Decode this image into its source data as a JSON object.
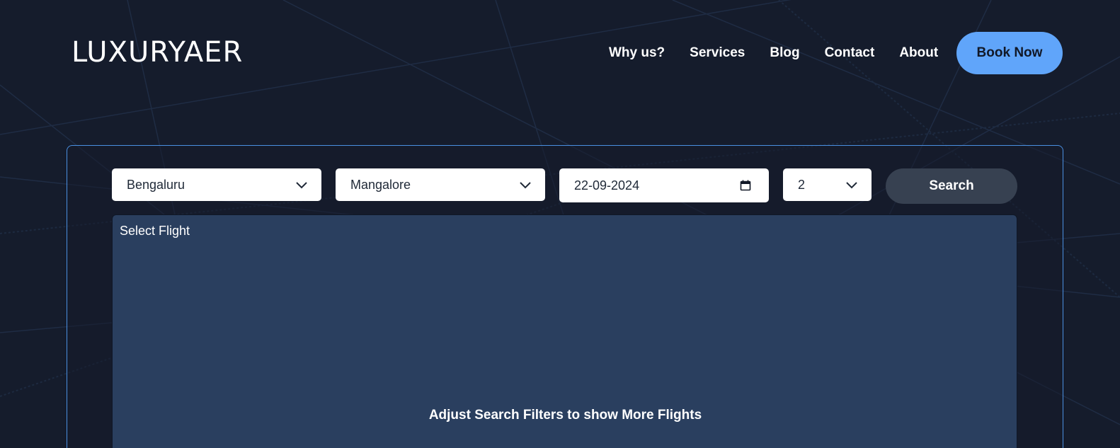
{
  "header": {
    "logo": "LUXURYAER",
    "nav": [
      "Why us?",
      "Services",
      "Blog",
      "Contact",
      "About"
    ],
    "cta_label": "Book Now"
  },
  "search": {
    "from": "Bengaluru",
    "to": "Mangalore",
    "date": "22-09-2024",
    "passengers": "2",
    "button_label": "Search"
  },
  "results": {
    "label": "Select Flight",
    "message": "Adjust Search Filters to show More Flights"
  },
  "colors": {
    "background": "#151c2c",
    "accent": "#60a5fa",
    "panel": "#2a3f5f"
  }
}
